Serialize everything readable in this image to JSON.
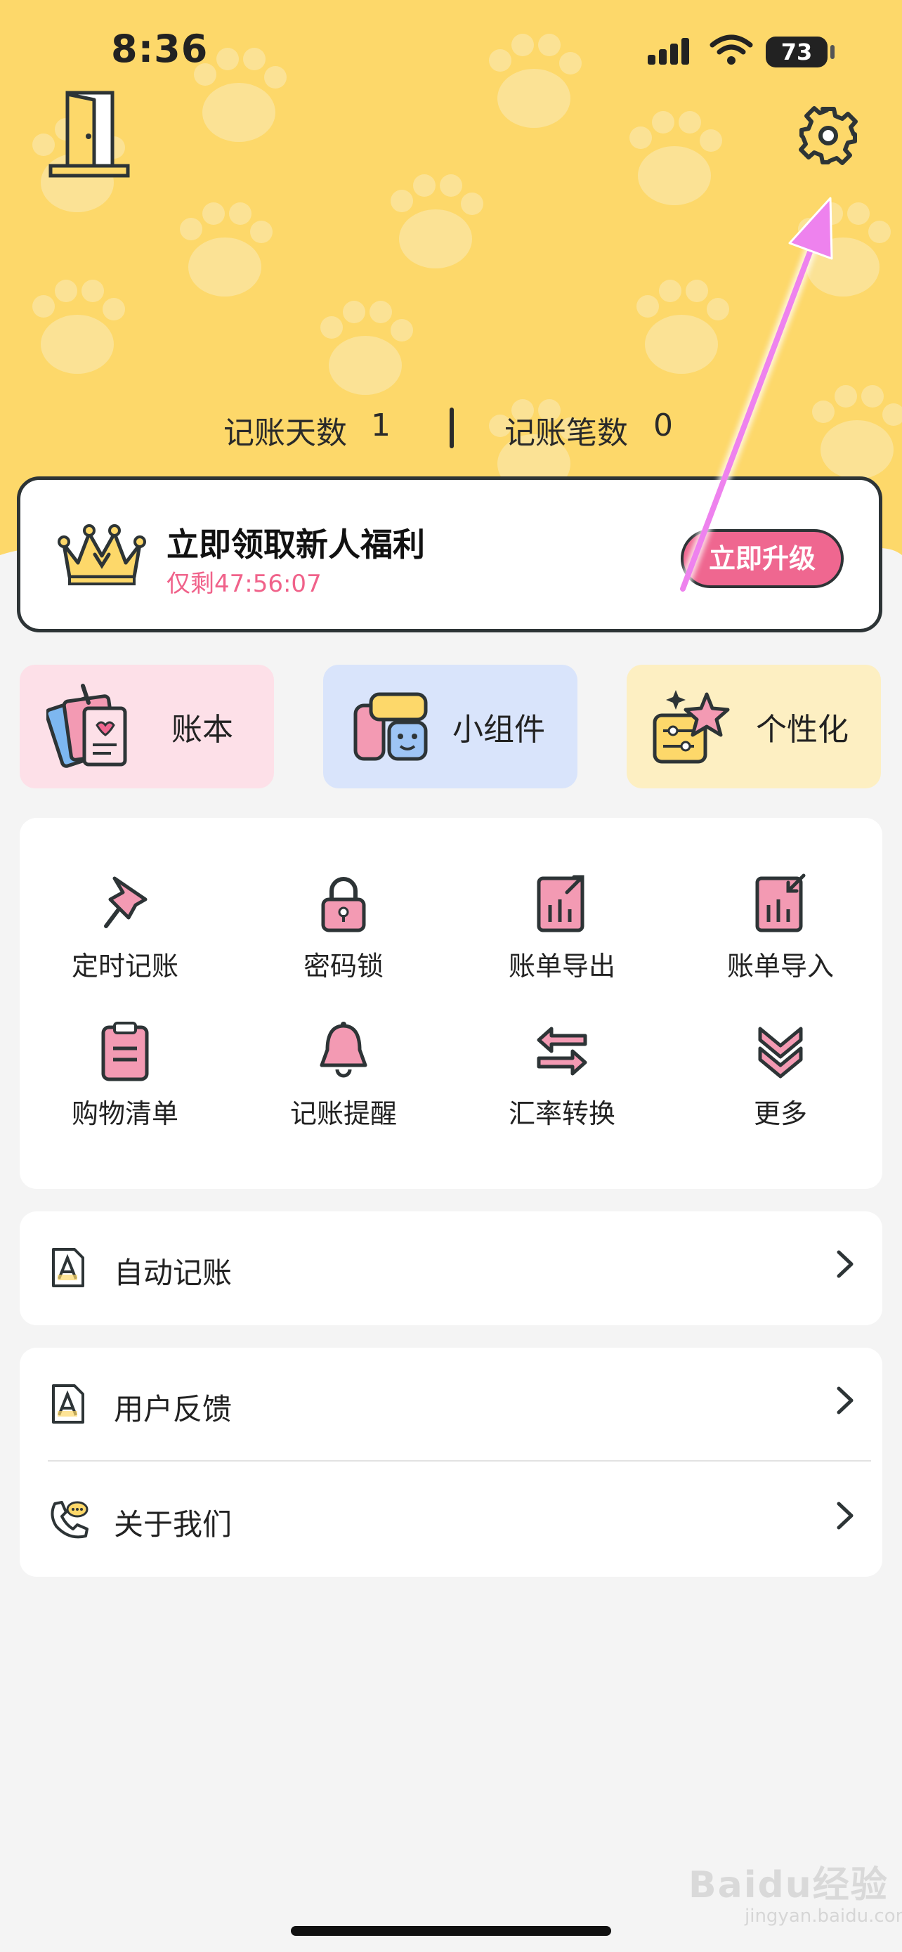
{
  "status_bar": {
    "time": "8:36",
    "battery": "73"
  },
  "header": {
    "stats": {
      "days_label": "记账天数",
      "days_value": "1",
      "count_label": "记账笔数",
      "count_value": "0"
    }
  },
  "promo": {
    "title": "立即领取新人福利",
    "countdown": "仅剩47:56:07",
    "button": "立即升级"
  },
  "quick_actions": [
    {
      "label": "账本",
      "icon": "ledger-book-icon"
    },
    {
      "label": "小组件",
      "icon": "widget-icon"
    },
    {
      "label": "个性化",
      "icon": "personalize-icon"
    }
  ],
  "tools": [
    {
      "label": "定时记账",
      "icon": "pin-icon"
    },
    {
      "label": "密码锁",
      "icon": "lock-icon"
    },
    {
      "label": "账单导出",
      "icon": "export-icon"
    },
    {
      "label": "账单导入",
      "icon": "import-icon"
    },
    {
      "label": "购物清单",
      "icon": "clipboard-icon"
    },
    {
      "label": "记账提醒",
      "icon": "bell-icon"
    },
    {
      "label": "汇率转换",
      "icon": "exchange-arrows-icon"
    },
    {
      "label": "更多",
      "icon": "double-chevron-down-icon"
    }
  ],
  "menu": {
    "auto_record": "自动记账",
    "feedback": "用户反馈",
    "about": "关于我们"
  },
  "watermark": {
    "text": "Baidu经验",
    "url": "jingyan.baidu.com"
  },
  "colors": {
    "header_yellow": "#fdd86a",
    "accent_pink": "#ef6790",
    "outline_dark": "#2d3436",
    "annotation_arrow": "#ee82ee"
  }
}
